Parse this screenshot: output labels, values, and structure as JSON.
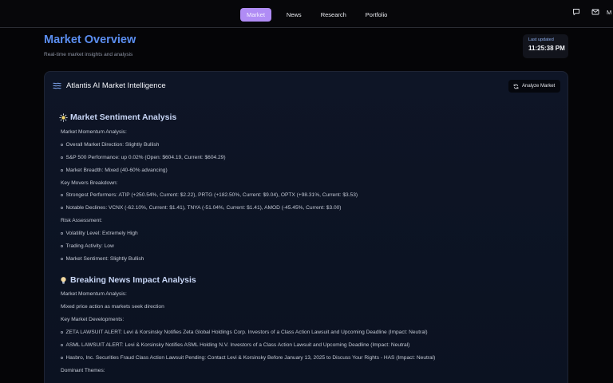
{
  "nav": {
    "items": [
      {
        "label": "Market",
        "active": true
      },
      {
        "label": "News",
        "active": false
      },
      {
        "label": "Research",
        "active": false
      },
      {
        "label": "Portfolio",
        "active": false
      }
    ],
    "icons": [
      "chat-icon",
      "mail-icon"
    ],
    "avatar_letter": "M"
  },
  "header": {
    "title": "Market Overview",
    "subtitle": "Real-time market insights and analysis"
  },
  "last_updated": {
    "label": "Last updated",
    "time": "11:25:38 PM"
  },
  "card": {
    "title": "Atlantis AI Market Intelligence",
    "analyze_label": "Analyze Market",
    "sentiment": {
      "title": "Market Sentiment Analysis",
      "momentum_heading": "Market Momentum Analysis:",
      "momentum_items": [
        "Overall Market Direction: Slightly Bullish",
        "S&P 500 Performance: up 0.02% (Open: $604.19, Current: $604.29)",
        "Market Breadth: Mixed (40-60% advancing)"
      ],
      "movers_heading": "Key Movers Breakdown:",
      "movers_items": [
        "Strongest Performers: ATIP (+250.54%, Current: $2.22), PRTG (+182.50%, Current: $9.04), OPTX (+98.31%, Current: $3.53)",
        "Notable Declines: VCNX (-62.10%, Current: $1.41), TNYA (-51.04%, Current: $1.41), AMOD (-45.45%, Current: $3.00)"
      ],
      "risk_heading": "Risk Assessment:",
      "risk_items": [
        "Volatility Level: Extremely High",
        "Trading Activity: Low",
        "Market Sentiment: Slightly Bullish"
      ]
    },
    "news": {
      "title": "Breaking News Impact Analysis",
      "momentum_heading": "Market Momentum Analysis:",
      "momentum_text": "Mixed price action as markets seek direction",
      "developments_heading": "Key Market Developments:",
      "developments_items": [
        "ZETA LAWSUIT ALERT: Levi & Korsinsky Notifies Zeta Global Holdings Corp. Investors of a Class Action Lawsuit and Upcoming Deadline (Impact: Neutral)",
        "ASML LAWSUIT ALERT: Levi & Korsinsky Notifies ASML Holding N.V. Investors of a Class Action Lawsuit and Upcoming Deadline (Impact: Neutral)",
        "Hasbro, Inc. Securities Fraud Class Action Lawsuit Pending: Contact Levi & Korsinsky Before January 13, 2025 to Discuss Your Rights - HAS (Impact: Neutral)"
      ],
      "themes_heading": "Dominant Themes:"
    }
  }
}
